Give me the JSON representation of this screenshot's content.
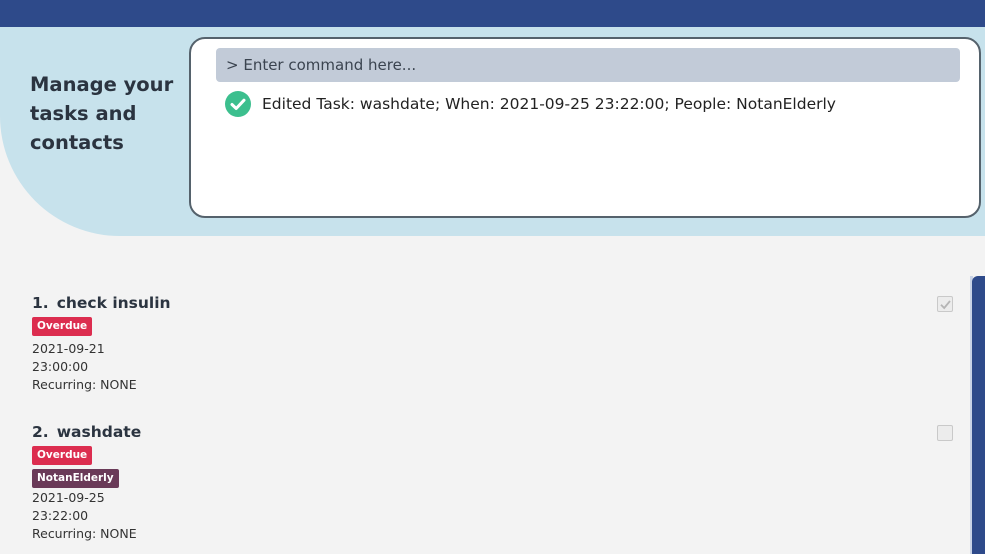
{
  "header": {
    "tagline": "Manage your tasks and contacts"
  },
  "command": {
    "placeholder": "> Enter command here...",
    "result_text": "Edited Task: washdate; When: 2021-09-25 23:22:00; People: NotanElderly",
    "result_status": "success"
  },
  "tasks": [
    {
      "index": "1.",
      "title": "check insulin",
      "tags": [
        "Overdue"
      ],
      "people": [],
      "date": "2021-09-21",
      "time": "23:00:00",
      "recurring": "Recurring: NONE",
      "done": true
    },
    {
      "index": "2.",
      "title": "washdate",
      "tags": [
        "Overdue"
      ],
      "people": [
        "NotanElderly"
      ],
      "date": "2021-09-25",
      "time": "23:22:00",
      "recurring": "Recurring: NONE",
      "done": false
    }
  ],
  "colors": {
    "topbar": "#2e4a8a",
    "hero": "#c7e2ec",
    "overdue_tag": "#dc2d4f",
    "person_tag": "#6a3a58",
    "success": "#3cbf8e"
  }
}
